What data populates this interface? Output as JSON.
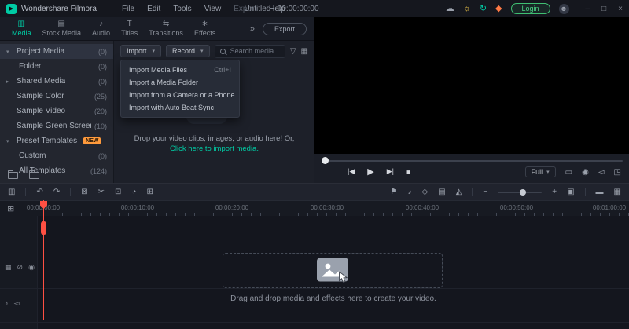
{
  "titlebar": {
    "app_name": "Wondershare Filmora",
    "menus": [
      "File",
      "Edit",
      "Tools",
      "View",
      "Export",
      "Help"
    ],
    "project_title": "Untitled : 00:00:00:00",
    "login_label": "Login",
    "icons": {
      "logo": "▶",
      "cloud": "☁",
      "bulb": "☼",
      "sync": "↻",
      "promo": "◆",
      "avatar": "☻",
      "minimize": "–",
      "maximize": "□",
      "close": "×"
    }
  },
  "tabbar": {
    "tabs": [
      {
        "icon": "▥",
        "label": "Media"
      },
      {
        "icon": "▤",
        "label": "Stock Media"
      },
      {
        "icon": "♪",
        "label": "Audio"
      },
      {
        "icon": "T",
        "label": "Titles"
      },
      {
        "icon": "⇆",
        "label": "Transitions"
      },
      {
        "icon": "∗",
        "label": "Effects"
      }
    ],
    "more_glyph": "»",
    "export_label": "Export"
  },
  "sidebar": {
    "items": [
      {
        "expander": "▾",
        "label": "Project Media",
        "count": "(0)"
      },
      {
        "expander": "",
        "label": "Folder",
        "count": "(0)"
      },
      {
        "expander": "▸",
        "label": "Shared Media",
        "count": "(0)"
      },
      {
        "expander": "",
        "label": "Sample Color",
        "count": "(25)"
      },
      {
        "expander": "",
        "label": "Sample Video",
        "count": "(20)"
      },
      {
        "expander": "",
        "label": "Sample Green Screen",
        "count": "(10)"
      },
      {
        "expander": "▾",
        "label": "Preset Templates",
        "count": "",
        "badge": "NEW"
      },
      {
        "expander": "",
        "label": "Custom",
        "count": "(0)"
      },
      {
        "expander": "",
        "label": "All Templates",
        "count": "(124)"
      }
    ]
  },
  "media_toolbar": {
    "import_label": "Import",
    "record_label": "Record",
    "caret": "▾",
    "search_placeholder": "Search media",
    "filter_glyph": "▽",
    "grid_glyph": "▦"
  },
  "import_menu": {
    "items": [
      {
        "label": "Import Media Files",
        "shortcut": "Ctrl+I"
      },
      {
        "label": "Import a Media Folder",
        "shortcut": ""
      },
      {
        "label": "Import from a Camera or a Phone",
        "shortcut": ""
      },
      {
        "label": "Import with Auto Beat Sync",
        "shortcut": ""
      }
    ]
  },
  "empty_state": {
    "arrow_glyph": "↓",
    "line1": "Drop your video clips, images, or audio here! Or,",
    "link": "Click here to import media."
  },
  "preview": {
    "transport": [
      {
        "name": "previous-frame",
        "glyph": "|◀"
      },
      {
        "name": "play",
        "glyph": "▶"
      },
      {
        "name": "next-frame",
        "glyph": "▶|"
      },
      {
        "name": "stop",
        "glyph": "■"
      }
    ],
    "quality_label": "Full",
    "quality_caret": "▾",
    "icons": [
      {
        "name": "float-window",
        "glyph": "▭"
      },
      {
        "name": "snapshot",
        "glyph": "◉"
      },
      {
        "name": "volume",
        "glyph": "◅"
      },
      {
        "name": "fullscreen",
        "glyph": "◳"
      }
    ]
  },
  "timeline_toolbar": {
    "left": [
      {
        "name": "media-tool",
        "glyph": "▥"
      },
      {
        "name": "undo",
        "glyph": "↶"
      },
      {
        "name": "redo",
        "glyph": "↷"
      },
      {
        "name": "delete",
        "glyph": "⊠"
      },
      {
        "name": "split",
        "glyph": "✂"
      },
      {
        "name": "crop",
        "glyph": "⊡"
      },
      {
        "name": "speed",
        "glyph": "◔"
      },
      {
        "name": "properties",
        "glyph": "⊞"
      }
    ],
    "right": [
      {
        "name": "marker",
        "glyph": "⚑"
      },
      {
        "name": "voiceover",
        "glyph": "♪"
      },
      {
        "name": "keyframe",
        "glyph": "◇"
      },
      {
        "name": "mixer",
        "glyph": "▤"
      },
      {
        "name": "render-preview",
        "glyph": "◭"
      }
    ],
    "zoom_out": "−",
    "zoom_in": "+",
    "fit": "▣",
    "view_toggles": [
      {
        "name": "view-compact",
        "glyph": "▬"
      },
      {
        "name": "view-detail",
        "glyph": "▦"
      }
    ]
  },
  "timeline": {
    "manage_tracks_glyph": "⊞",
    "ruler_labels": [
      "00:00:00:00",
      "00:00:10:00",
      "00:00:20:00",
      "00:00:30:00",
      "00:00:40:00",
      "00:00:50:00",
      "00:01:00:00"
    ],
    "video_track_icons": [
      {
        "name": "track-size",
        "glyph": "▦"
      },
      {
        "name": "lock-track",
        "glyph": "⊘"
      },
      {
        "name": "hide-track",
        "glyph": "◉"
      }
    ],
    "audio_track_icons": [
      {
        "name": "voiceover-track",
        "glyph": "♪"
      },
      {
        "name": "mute-track",
        "glyph": "◅"
      }
    ],
    "drop_hint": "Drag and drop media and effects here to create your video."
  },
  "colors": {
    "accent": "#00cba4",
    "login_green": "#3fbf72",
    "badge_orange": "#ff9a3c",
    "playhead_red": "#ff5043"
  }
}
